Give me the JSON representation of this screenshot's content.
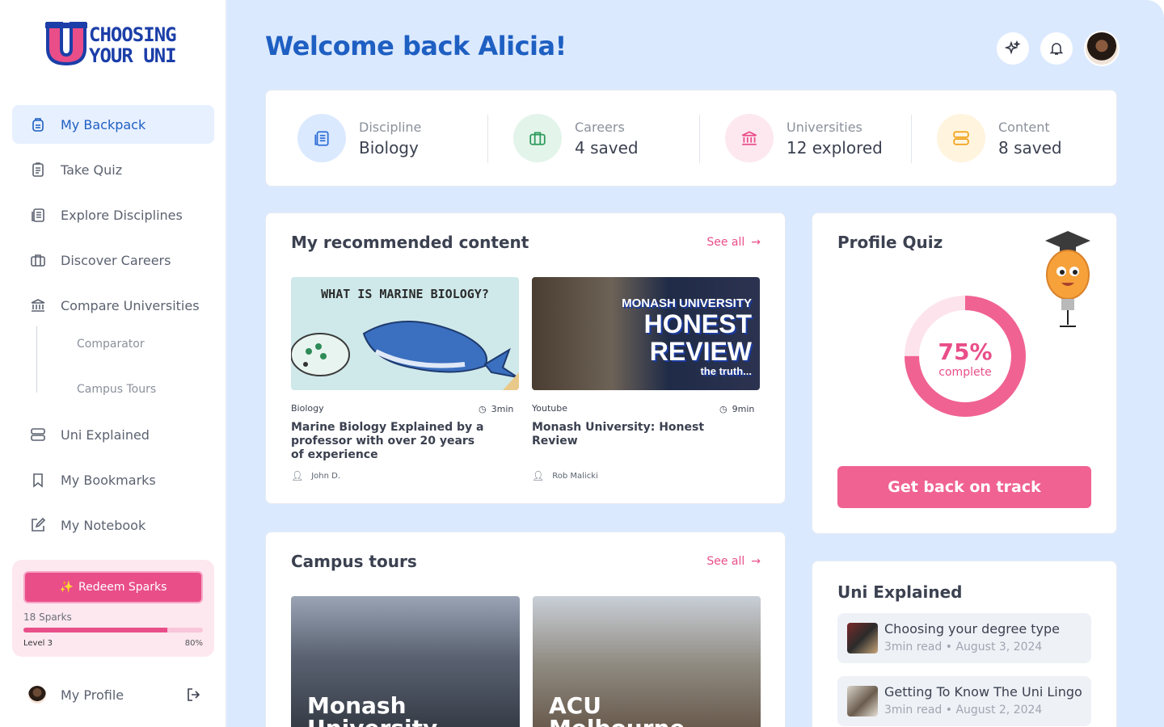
{
  "brand": {
    "logo_line1": "CHOOSING",
    "logo_line2": "YOUR UNI",
    "logo_letter": "U"
  },
  "sidebar": {
    "items": [
      {
        "label": "My Backpack",
        "icon": "backpack-icon",
        "active": true
      },
      {
        "label": "Take Quiz",
        "icon": "clipboard-icon"
      },
      {
        "label": "Explore Disciplines",
        "icon": "book-icon"
      },
      {
        "label": "Discover Careers",
        "icon": "briefcase-icon"
      },
      {
        "label": "Compare Universities",
        "icon": "university-icon"
      },
      {
        "label": "Uni Explained",
        "icon": "server-icon"
      },
      {
        "label": "My Bookmarks",
        "icon": "bookmark-icon"
      },
      {
        "label": "My Notebook",
        "icon": "edit-icon"
      }
    ],
    "subitems": [
      "Comparator",
      "Campus Tours"
    ],
    "sparks": {
      "button": "Redeem Sparks",
      "count": "18 Sparks",
      "level": "Level 3",
      "percent_label": "80%",
      "progress": 0.8
    },
    "profile_label": "My Profile"
  },
  "header": {
    "welcome": "Welcome back Alicia!"
  },
  "stats": [
    {
      "label": "Discipline",
      "value": "Biology",
      "color": "#dbe9ff",
      "icon_color": "#2f6fd6"
    },
    {
      "label": "Careers",
      "value": "4 saved",
      "color": "#e3f4ea",
      "icon_color": "#2e9b5c"
    },
    {
      "label": "Universities",
      "value": "12 explored",
      "color": "#fde8f0",
      "icon_color": "#e94e89"
    },
    {
      "label": "Content",
      "value": "8 saved",
      "color": "#fff4de",
      "icon_color": "#f0a21a"
    }
  ],
  "recommended": {
    "title": "My recommended content",
    "see_all": "See all",
    "items": [
      {
        "thumb_text": "WHAT IS MARINE BIOLOGY?",
        "tag": "Biology",
        "time": "3min",
        "title": "Marine Biology Explained by a professor with over 20 years of experience",
        "author": "John D."
      },
      {
        "thumb_line1": "MONASH UNIVERSITY",
        "thumb_line2": "HONEST",
        "thumb_line3": "REVIEW",
        "thumb_line4": "the truth...",
        "tag": "Youtube",
        "time": "9min",
        "title": "Monash University: Honest Review",
        "author": "Rob Malicki"
      }
    ]
  },
  "campus": {
    "title": "Campus tours",
    "see_all": "See all",
    "items": [
      {
        "line1": "Monash",
        "line2": "University"
      },
      {
        "line1": "ACU",
        "line2": "Melbourne"
      }
    ]
  },
  "quiz": {
    "title": "Profile Quiz",
    "percent": "75%",
    "percent_value": 75,
    "complete_label": "complete",
    "cta": "Get back on track"
  },
  "uni_explained": {
    "title": "Uni Explained",
    "items": [
      {
        "title": "Choosing your degree type",
        "meta": "3min read • August 3, 2024"
      },
      {
        "title": "Getting To Know The Uni Lingo",
        "meta": "3min read • August 2, 2024"
      }
    ]
  },
  "colors": {
    "primary": "#1e5fc2",
    "accent": "#e94e89",
    "background": "#dbe9ff"
  }
}
